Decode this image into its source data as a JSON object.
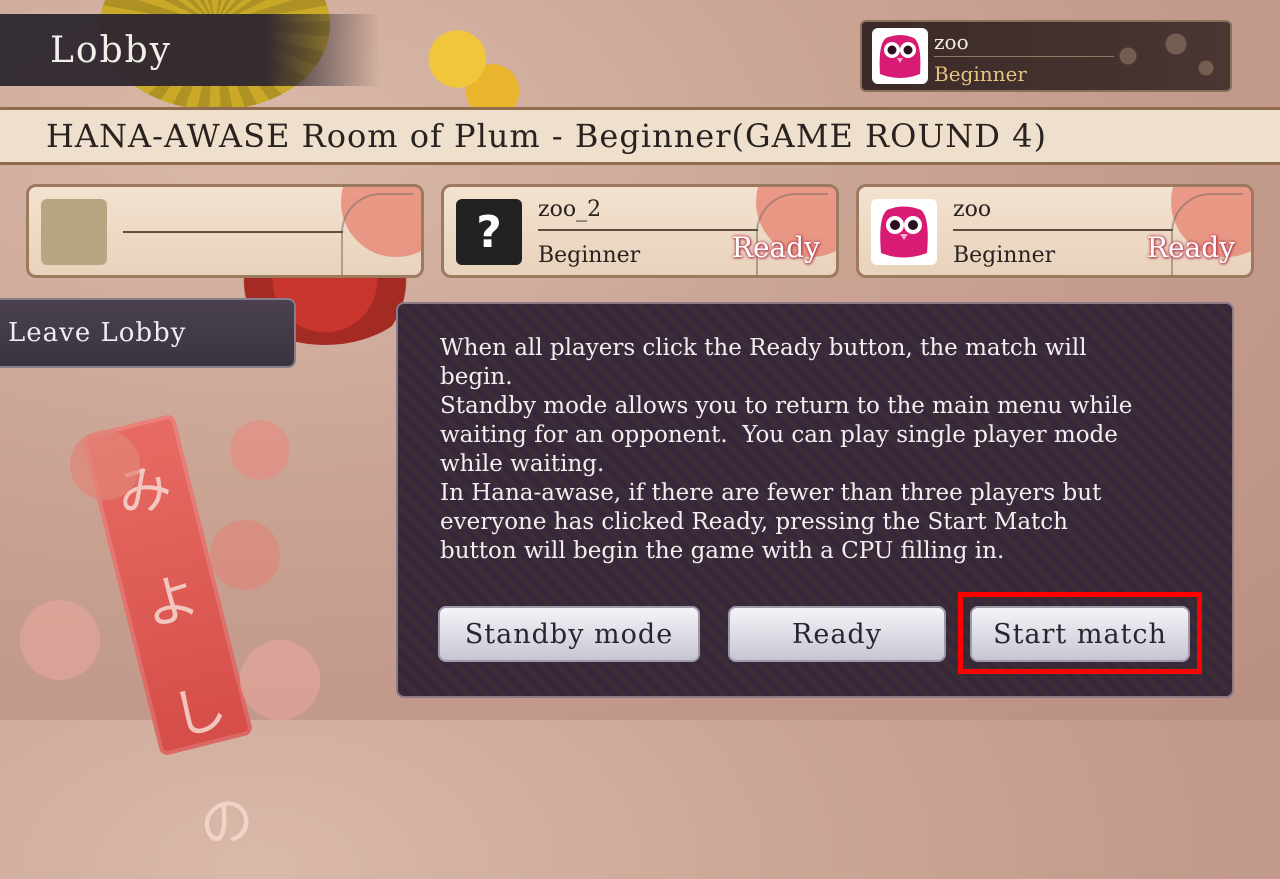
{
  "header": {
    "lobby_label": "Lobby",
    "room_title": "HANA-AWASE Room of Plum - Beginner(GAME ROUND 4)"
  },
  "user": {
    "name": "zoo",
    "rank": "Beginner",
    "avatar_icon": "owl-avatar-icon"
  },
  "players": [
    {
      "name": "",
      "rank": "",
      "status": ""
    },
    {
      "name": "zoo_2",
      "rank": "Beginner",
      "status": "Ready",
      "avatar_icon": "question-mark-icon",
      "avatar_glyph": "?"
    },
    {
      "name": "zoo",
      "rank": "Beginner",
      "status": "Ready",
      "avatar_icon": "owl-avatar-icon"
    }
  ],
  "sidebar": {
    "leave_label": "Leave Lobby"
  },
  "info_text": "When all players click the Ready button, the match will\nbegin.\nStandby mode allows you to return to the main menu while\nwaiting for an opponent.  You can play single player mode\nwhile waiting.\nIn Hana-awase, if there are fewer than three players but\neveryone has clicked Ready, pressing the Start Match\nbutton will begin the game with a CPU filling in.",
  "buttons": {
    "standby": "Standby mode",
    "ready": "Ready",
    "start": "Start match"
  },
  "colors": {
    "ready_text": "#ffffff",
    "ready_glow": "#c24a5c",
    "owl_pink": "#d81b73",
    "highlight": "#ff0000"
  },
  "banner_glyphs": "みよしの"
}
